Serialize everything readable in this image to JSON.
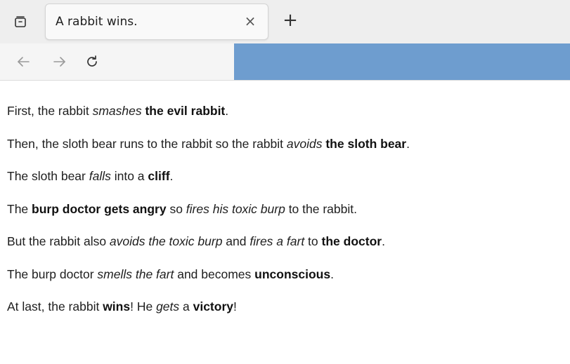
{
  "browser": {
    "tab_title": "A rabbit wins.",
    "tab_close": "×",
    "new_tab": "+"
  },
  "icons": {
    "tabs_list": "tabs-list-icon",
    "back": "back-arrow-icon",
    "forward": "forward-arrow-icon",
    "reload": "reload-icon"
  },
  "colors": {
    "url_bar": "#6e9dcf"
  },
  "story": {
    "l1": {
      "a": "First, the rabbit ",
      "b": "smashes",
      "c": "the evil rabbit",
      "d": "."
    },
    "l2": {
      "a": "Then, the sloth bear runs to the rabbit so the rabbit ",
      "b": "avoids",
      "c": "the sloth bear",
      "d": "."
    },
    "l3": {
      "a": "The sloth bear ",
      "b": "falls",
      "c": " into a ",
      "d": "cliff",
      "e": "."
    },
    "l4": {
      "a": "The ",
      "b": "burp doctor gets angry",
      "c": " so ",
      "d": "fires his toxic burp",
      "e": " to the rabbit."
    },
    "l5": {
      "a": "But the rabbit also ",
      "b": "avoids the toxic burp",
      "c": " and ",
      "d": "fires a fart",
      "e": " to ",
      "f": "the doctor",
      "g": "."
    },
    "l6": {
      "a": "The burp doctor ",
      "b": "smells the fart",
      "c": " and becomes ",
      "d": "unconscious",
      "e": "."
    },
    "l7": {
      "a": "At last, the rabbit ",
      "b": "wins",
      "c": "! He ",
      "d": "gets",
      "e": " a ",
      "f": "victory",
      "g": "!"
    }
  }
}
